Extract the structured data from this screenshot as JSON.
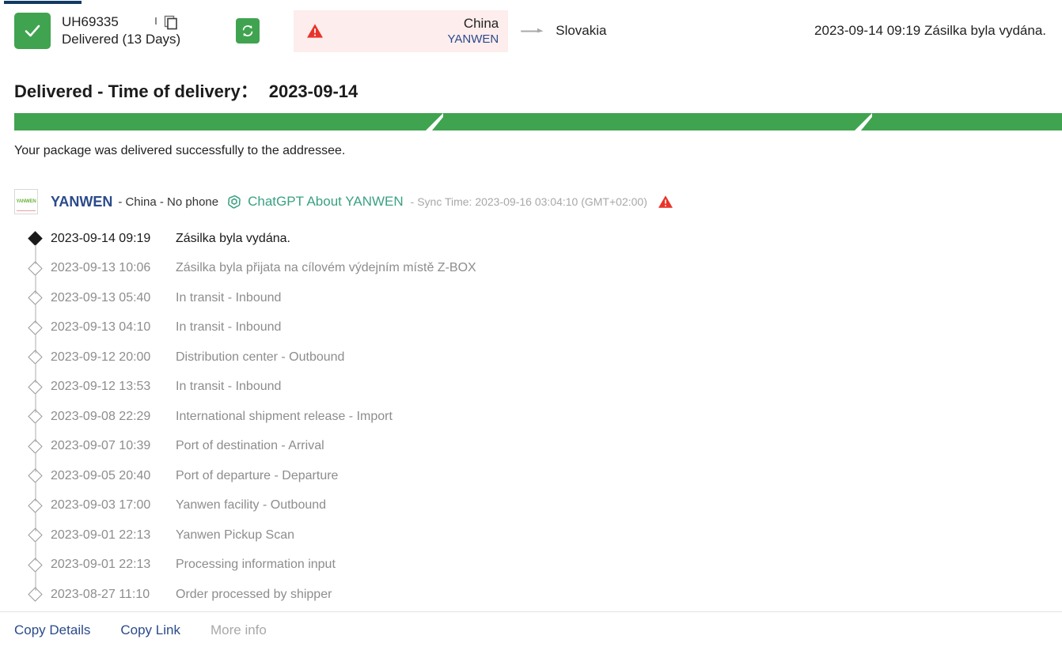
{
  "header": {
    "status_icon": "check-icon",
    "tracking_number": "UH69335",
    "delivered_label": "Delivered (13 Days)",
    "copy_icon": "copy-icon",
    "refresh_icon": "refresh-icon",
    "warning_icon": "warning-triangle-icon",
    "origin_country": "China",
    "origin_carrier": "YANWEN",
    "route_arrow_icon": "arrow-right-icon",
    "destination_country": "Slovakia",
    "latest_event": "2023-09-14 09:19 Zásilka byla vydána."
  },
  "summary": {
    "title": "Delivered - Time of delivery：",
    "delivery_date": "2023-09-14",
    "message": "Your package was delivered successfully to the addressee.",
    "progress_segments": 3,
    "progress_color": "#40a350"
  },
  "carrier": {
    "logo_text": "YANWEN",
    "name": "YANWEN",
    "meta": "- China  - No phone",
    "gpt_icon": "chatgpt-icon",
    "gpt_link": "ChatGPT About YANWEN",
    "sync_time": "- Sync Time: 2023-09-16 03:04:10 (GMT+02:00)",
    "warning_icon": "warning-triangle-icon"
  },
  "events": [
    {
      "time": "2023-09-14 09:19",
      "desc": "Zásilka byla vydána.",
      "active": true
    },
    {
      "time": "2023-09-13 10:06",
      "desc": "Zásilka byla přijata na cílovém výdejním místě Z-BOX",
      "active": false
    },
    {
      "time": "2023-09-13 05:40",
      "desc": "In transit - Inbound",
      "active": false
    },
    {
      "time": "2023-09-13 04:10",
      "desc": "In transit - Inbound",
      "active": false
    },
    {
      "time": "2023-09-12 20:00",
      "desc": "Distribution center - Outbound",
      "active": false
    },
    {
      "time": "2023-09-12 13:53",
      "desc": "In transit - Inbound",
      "active": false
    },
    {
      "time": "2023-09-08 22:29",
      "desc": "International shipment release - Import",
      "active": false
    },
    {
      "time": "2023-09-07 10:39",
      "desc": "Port of destination - Arrival",
      "active": false
    },
    {
      "time": "2023-09-05 20:40",
      "desc": "Port of departure - Departure",
      "active": false
    },
    {
      "time": "2023-09-03 17:00",
      "desc": "Yanwen facility - Outbound",
      "active": false
    },
    {
      "time": "2023-09-01 22:13",
      "desc": "Yanwen Pickup Scan",
      "active": false
    },
    {
      "time": "2023-09-01 22:13",
      "desc": "Processing information input",
      "active": false
    },
    {
      "time": "2023-08-27 11:10",
      "desc": "Order processed by shipper",
      "active": false
    }
  ],
  "footer": {
    "copy_details": "Copy Details",
    "copy_link": "Copy Link",
    "more_info": "More info"
  }
}
